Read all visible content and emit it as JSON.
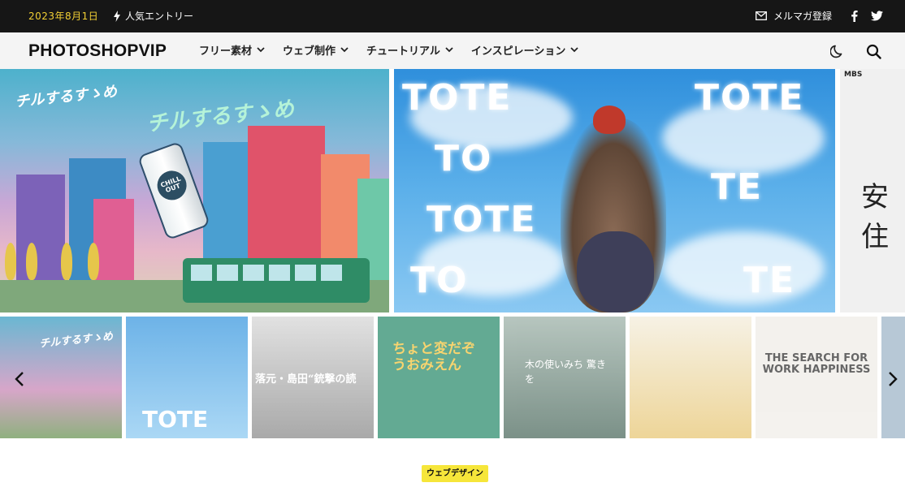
{
  "topbar": {
    "date": "2023年8月1日",
    "popular_label": "人気エントリー",
    "newsletter_label": "メルマガ登録",
    "colors": {
      "background": "#161616",
      "date": "#f2d034"
    }
  },
  "header": {
    "logo": "PHOTOSHOPVIP",
    "nav": [
      {
        "label": "フリー素材"
      },
      {
        "label": "ウェブ制作"
      },
      {
        "label": "チュートリアル"
      },
      {
        "label": "インスピレーション"
      }
    ],
    "icons": [
      "moon-icon",
      "search-icon"
    ]
  },
  "hero": {
    "slides": [
      {
        "title": "チルするすゝめ",
        "corner_title": "チルするすゝめ",
        "can_label": "CHILL OUT"
      },
      {
        "words": [
          "TOTE",
          "TOTE",
          "TO",
          "TE",
          "TOTE",
          "TO",
          "TE"
        ]
      },
      {
        "tag": "MBS",
        "text": "安住"
      }
    ]
  },
  "thumbnails": [
    {
      "text": "チルするすゝめ"
    },
    {
      "text": "TOTE"
    },
    {
      "text": "落元・島田“銃撃の読"
    },
    {
      "text": "ちょと変だぞ うおみえん"
    },
    {
      "text": "木の使いみち 驚きを"
    },
    {
      "text": ""
    },
    {
      "text": "THE SEARCH FOR WORK HAPPINESS"
    },
    {
      "text": ""
    }
  ],
  "category_badge": "ウェブデザイン",
  "colors": {
    "badge": "#f6e63a"
  }
}
